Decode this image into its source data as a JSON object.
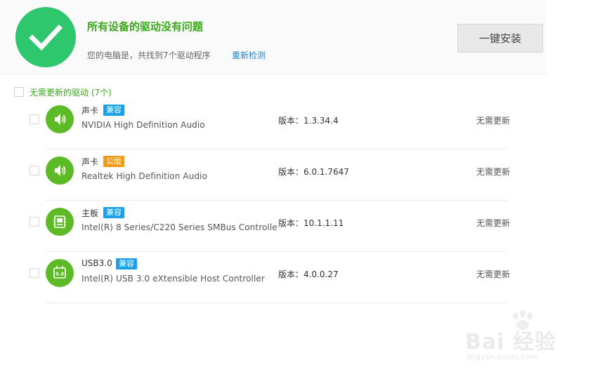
{
  "header": {
    "status_title": "所有设备的驱动没有问题",
    "status_subtitle": "您的电脑是，共找到7个驱动程序",
    "rescan_label": "重新检测",
    "install_label": "一键安装",
    "status_icon": "checkmark-icon",
    "accent_color": "#2ec76d"
  },
  "group": {
    "label": "无需更新的驱动 (7个)"
  },
  "drivers": [
    {
      "category": "声卡",
      "badge": "兼容",
      "badge_color": "#1aa0e6",
      "device": "NVIDIA High Definition Audio",
      "version": "版本：1.3.34.4",
      "status": "无需更新",
      "icon": "speaker-icon"
    },
    {
      "category": "声卡",
      "badge": "公版",
      "badge_color": "#f29a1b",
      "device": "Realtek High Definition Audio",
      "version": "版本：6.0.1.7647",
      "status": "无需更新",
      "icon": "speaker-icon"
    },
    {
      "category": "主板",
      "badge": "兼容",
      "badge_color": "#1aa0e6",
      "device": "Intel(R) 8 Series/C220 Series SMBus Controlle",
      "version": "版本：10.1.1.11",
      "status": "无需更新",
      "icon": "motherboard-icon"
    },
    {
      "category": "USB3.0",
      "badge": "兼容",
      "badge_color": "#1aa0e6",
      "device": "Intel(R) USB 3.0 eXtensible Host Controller",
      "version": "版本：4.0.0.27",
      "status": "无需更新",
      "icon": "usb-icon"
    }
  ],
  "usb_icon_label": "3.0",
  "watermark": {
    "main": "Bai 经验",
    "sub": "jingyan.baidu.com"
  }
}
